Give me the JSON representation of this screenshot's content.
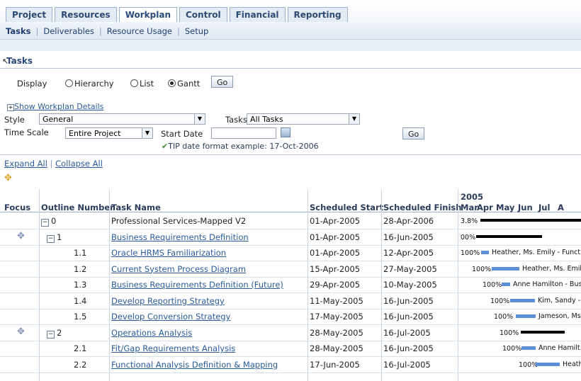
{
  "tabs": [
    "Project",
    "Resources",
    "Workplan",
    "Control",
    "Financial",
    "Reporting"
  ],
  "subtabs": [
    "Tasks",
    "Deliverables",
    "Resource Usage",
    "Setup"
  ],
  "section_title": "Tasks",
  "display": {
    "label": "Display",
    "options": [
      "Hierarchy",
      "List",
      "Gantt"
    ],
    "selected": "Gantt",
    "go": "Go"
  },
  "show_details": "Show Workplan Details",
  "style": {
    "label": "Style",
    "value": "General"
  },
  "tasks_filter": {
    "label": "Tasks",
    "value": "All Tasks"
  },
  "time_scale": {
    "label": "Time Scale",
    "value": "Entire Project"
  },
  "start_date": {
    "label": "Start Date",
    "value": ""
  },
  "go2": "Go",
  "tip": "TIP date format example: 17-Oct-2006",
  "expand_all": "Expand All",
  "collapse_all": "Collapse All",
  "columns": {
    "focus": "Focus",
    "outline": "Outline Number",
    "task": "Task Name",
    "start": "Scheduled Start",
    "finish": "Scheduled Finish"
  },
  "gantt": {
    "year": "2005",
    "months": [
      "Mar",
      "Apr",
      "May",
      "Jun",
      "Jul",
      "A"
    ]
  },
  "rows": [
    {
      "outline": "0",
      "task": "Professional Services-Mapped V2",
      "start": "01-Apr-2005",
      "finish": "28-Apr-2006",
      "link": false,
      "focus": false,
      "toggle": true,
      "pct": "3.8%",
      "label": ""
    },
    {
      "outline": "1",
      "task": "Business Requirements Definition",
      "start": "01-Apr-2005",
      "finish": "16-Jun-2005",
      "link": true,
      "focus": true,
      "toggle": true,
      "pct": "00%",
      "label": ""
    },
    {
      "outline": "1.1",
      "task": "Oracle HRMS Familiarization",
      "start": "01-Apr-2005",
      "finish": "12-Apr-2005",
      "link": true,
      "focus": false,
      "toggle": false,
      "pct": "100%",
      "label": "Heather, Ms. Emily - Functio"
    },
    {
      "outline": "1.2",
      "task": "Current System Process Diagram",
      "start": "15-Apr-2005",
      "finish": "27-May-2005",
      "link": true,
      "focus": false,
      "toggle": false,
      "pct": "100%",
      "label": "Heather, Ms. Emil"
    },
    {
      "outline": "1.3",
      "task": "Business Requirements Definition (Future)",
      "start": "29-Apr-2005",
      "finish": "10-May-2005",
      "link": true,
      "focus": false,
      "toggle": false,
      "pct": "100%",
      "label": "Anne Hamilton - Busi"
    },
    {
      "outline": "1.4",
      "task": "Develop Reporting Strategy",
      "start": "11-May-2005",
      "finish": "16-Jun-2005",
      "link": true,
      "focus": false,
      "toggle": false,
      "pct": "100%",
      "label": "Kim, Sandy -"
    },
    {
      "outline": "1.5",
      "task": "Develop Conversion Strategy",
      "start": "17-May-2005",
      "finish": "16-Jun-2005",
      "link": true,
      "focus": false,
      "toggle": false,
      "pct": "100%",
      "label": "Jameson, Ms"
    },
    {
      "outline": "2",
      "task": "Operations Analysis",
      "start": "28-May-2005",
      "finish": "16-Jul-2005",
      "link": true,
      "focus": true,
      "toggle": true,
      "pct": "100%",
      "label": ""
    },
    {
      "outline": "2.1",
      "task": "Fit/Gap Requirements Analysis",
      "start": "28-May-2005",
      "finish": "16-Jun-2005",
      "link": true,
      "focus": false,
      "toggle": false,
      "pct": "100%",
      "label": "Anne Hamilt"
    },
    {
      "outline": "2.2",
      "task": "Functional Analysis Definition & Mapping",
      "start": "17-Jun-2005",
      "finish": "16-Jul-2005",
      "link": true,
      "focus": false,
      "toggle": false,
      "pct": "100%",
      "label": "Heath"
    }
  ]
}
